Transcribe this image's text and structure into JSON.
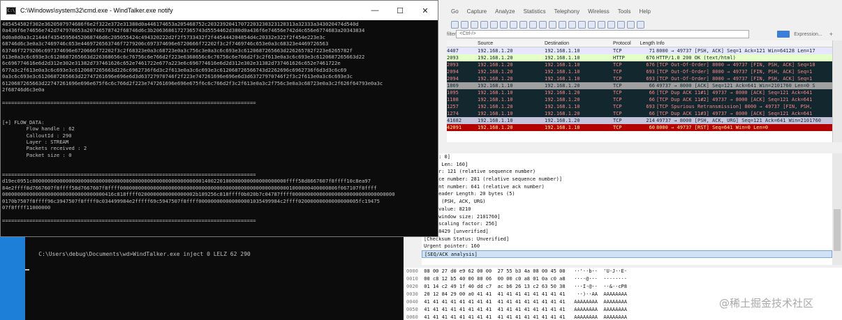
{
  "wireshark": {
    "menu": [
      "Go",
      "Capture",
      "Analyze",
      "Statistics",
      "Telephony",
      "Wireless",
      "Tools",
      "Help"
    ],
    "filter": {
      "label": "filter",
      "placeholder": "<Ctrl-/>",
      "expression_label": "Expression...",
      "plus": "+"
    },
    "packet_columns": [
      "Source",
      "Destination",
      "Protocol",
      "Length",
      "Info"
    ],
    "packets": [
      {
        "no": "4407",
        "src": "192.168.1.20",
        "dst": "192.168.1.10",
        "proto": "TCP",
        "len": "71",
        "info": "8000 → 49737 [PSH, ACK] Seq=1 Ack=121 Win=64128 Len=17",
        "bg": "#e7e6ff",
        "fg": "#12272e"
      },
      {
        "no": "2093",
        "src": "192.168.1.20",
        "dst": "192.168.1.10",
        "proto": "HTTP",
        "len": "676",
        "info": "HTTP/1.0 200 OK  (text/html)",
        "bg": "#e4ffc7",
        "fg": "#12272e"
      },
      {
        "no": "2093",
        "src": "192.168.1.20",
        "dst": "192.168.1.10",
        "proto": "TCP",
        "len": "676",
        "info": "[TCP Out-Of-Order] 8000 → 49737 [FIN, PSH, ACK] Seq=18",
        "bg": "#12272e",
        "fg": "#f78787"
      },
      {
        "no": "2094",
        "src": "192.168.1.20",
        "dst": "192.168.1.10",
        "proto": "TCP",
        "len": "693",
        "info": "[TCP Out-Of-Order] 8000 → 49737 [FIN, PSH, ACK] Seq=1",
        "bg": "#12272e",
        "fg": "#f78787"
      },
      {
        "no": "2094",
        "src": "192.168.1.20",
        "dst": "192.168.1.10",
        "proto": "TCP",
        "len": "693",
        "info": "[TCP Out-Of-Order] 8000 → 49737 [FIN, PSH, ACK] Seq=1",
        "bg": "#12272e",
        "fg": "#f78787"
      },
      {
        "no": "1869",
        "src": "192.168.1.10",
        "dst": "192.168.1.20",
        "proto": "TCP",
        "len": "66",
        "info": "49737 → 8000 [ACK] Seq=121 Ack=641 Win=2101760 Len=0 S",
        "bg": "#a0a0a0",
        "fg": "#12272e"
      },
      {
        "no": "1095",
        "src": "192.168.1.10",
        "dst": "192.168.1.20",
        "proto": "TCP",
        "len": "66",
        "info": "[TCP Dup ACK 11#1] 49737 → 8000 [ACK] Seq=121 Ack=641",
        "bg": "#12272e",
        "fg": "#f78787"
      },
      {
        "no": "1108",
        "src": "192.168.1.10",
        "dst": "192.168.1.20",
        "proto": "TCP",
        "len": "66",
        "info": "[TCP Dup ACK 11#2] 49737 → 8000 [ACK] Seq=121 Ack=641",
        "bg": "#12272e",
        "fg": "#f78787"
      },
      {
        "no": "1257",
        "src": "192.168.1.20",
        "dst": "192.168.1.10",
        "proto": "TCP",
        "len": "693",
        "info": "[TCP Spurious Retransmission] 8000 → 49737 [FIN, PSH,",
        "bg": "#12272e",
        "fg": "#f78787"
      },
      {
        "no": "1274",
        "src": "192.168.1.10",
        "dst": "192.168.1.20",
        "proto": "TCP",
        "len": "66",
        "info": "[TCP Dup ACK 11#3] 49737 → 8000 [ACK] Seq=121 Ack=641",
        "bg": "#12272e",
        "fg": "#f78787"
      },
      {
        "no": "41682",
        "src": "192.168.1.10",
        "dst": "192.168.1.20",
        "proto": "TCP",
        "len": "214",
        "info": "49737 → 8000 [PSH, ACK, URG] Seq=121 Ack=641 Win=2101760",
        "bg": "#c4c4dc",
        "fg": "#12272e"
      },
      {
        "no": "42091",
        "src": "192.168.1.20",
        "dst": "192.168.1.10",
        "proto": "TCP",
        "len": "60",
        "info": "8000 → 49737 [RST] Seq=641 Win=0 Len=0",
        "bg": "#b30000",
        "fg": "#fffc9c"
      }
    ],
    "details": [
      "index: 0]",
      "gment Len: 160]",
      "number: 121    (relative sequence number)",
      "equence number: 281    (relative sequence number)]",
      "edgment number: 641    (relative ack number)",
      ". = Header Length: 20 bytes (5)",
      "0x038 (PSH, ACK, URG)",
      "size value: 8210",
      "ated window size: 2101760]",
      "size scaling factor: 256]",
      "m: 0x8429 [unverified]",
      "[Checksum Status: Unverified]",
      "Urgent pointer: 160",
      "[SEQ/ACK analysis]"
    ],
    "bytes": [
      {
        "off": "0000",
        "hex": "08 00 27 d0 e9 62 00 00  27 55 b3 4a 08 00 45 00",
        "ascii": "··'··b··  'U·J··E·"
      },
      {
        "off": "0010",
        "hex": "00 c8 12 b5 40 00 80 06  00 00 c0 a8 01 0a c0 a8",
        "ascii": "····@···  ········"
      },
      {
        "off": "0020",
        "hex": "01 14 c2 49 1f 40 dd c7  ac b6 26 13 c2 63 50 38",
        "ascii": "···I·@··  ··&··cP8"
      },
      {
        "off": "0030",
        "hex": "20 12 84 29 00 a0 41 41  41 41 41 41 41 41 41 41",
        "ascii": " ··)··AA  AAAAAAAA"
      },
      {
        "off": "0040",
        "hex": "41 41 41 41 41 41 41 41  41 41 41 41 41 41 41 41",
        "ascii": "AAAAAAAA  AAAAAAAA"
      },
      {
        "off": "0050",
        "hex": "41 41 41 41 41 41 41 41  41 41 41 41 41 41 41 41",
        "ascii": "AAAAAAAA  AAAAAAAA"
      },
      {
        "off": "0060",
        "hex": "41 41 41 41 41 41 41 41  41 41 41 41 41 41 41 41",
        "ascii": "AAAAAAAA  AAAAAAAA"
      }
    ],
    "watermark": "@稀土掘金技术社区"
  },
  "cmd_notify": {
    "title": "C:\\Windows\\system32\\cmd.exe - WindTalker.exe  notify",
    "icon": "C:\\",
    "minimize": "—",
    "maximize": "☐",
    "close": "✕",
    "lines": [
      "485454502f302e3620507974686f6e2f322e372e31380d0a446174653a205468752c20323920417072203230323120313a32333a343020474d540d",
      "0a436f6e74656e742d747970653a20746578742f68746d6c3b20636861727365743d5554462d380d0a436f6e74656e742d4c656e6774683a20343834",
      "0d0a0d0a3c21444f43545950452068746d6c205055424c494320222d2f2f5733432f2f445444204854d4c20332e322f2f454e223e3c",
      "68746d6c3e0a3c7469746c653e4469726563746f7279206c697374696e6720666f72202f3c2f7469746c653e0a3c68323e4469726563",
      "63746f7279206c697374696e6720666f72202f3c2f68323e0a3c68723e0a3c756c3e0a3c6c693e3c6120687265663d226265782f223e6265782f",
      "613e0a3c6c693e3c6120687265663d226368656c6c76756c6e766d2f223e6368656c6c76756c6e766d2f3c2f613e0a3c6c693e3c6120687265663d22",
      "6c696774616e6d2d312e302e31382d737461626c652e7461722e677a223e6c696774616e6d2d312e302e31382d737461626c652e7461722e",
      "677a3c2f613e0a3c6c693e3c6120687265663d226c6962736f6d3c2f613e0a3c6c693e3c612068726566743d2262696c6962736f6d3d3c6c69",
      "0a3c6c693e3c6120687265663d22747261696e696e6d3d63727970746f2f223e747261696e696e6d3d63727970746f2f3c2f613e0a3c6c693e3c",
      "6120687265663d22747261696e696e675f6c6c766d2f223e747261696e696e675f6c6c766d2f3c2f613e0a3c2f756c3e0a3c68723e0a3c2f626f64793e0a3c",
      "2f68746d6c3e0a",
      "",
      "====================================================================================",
      "",
      "",
      "[+] FLOW_DATA:",
      "        Flow handle : 62",
      "        CalloutId : 290",
      "        Layer : STREAM",
      "        Packets received : 2",
      "        Packet size : 0",
      "",
      "",
      "====================================================================================",
      "d19ec0951c000000000000000000000000000000000000000000000000000000001400220100000000000000000000ffff58d8667607f8ffff10c8ea97",
      "84e2ffff8d7667607f8ffff58d7667607f8ffff000000000000000000000000000000000000000000000000000000001000000400000806f067107f8ffff",
      "0000000000000000000000000000000000416c818ffff0200000000000000002b189256c818ffff0b020b7c04787ffff0000000000000000000000000000000000",
      "0170b7507f8ffff96c3947507f8ffff0c034499984e2fffff69c5947507f8ffff000000000000000001035499984c2ffff02000000000000000005fc19475",
      "07f8ffff11000000",
      "",
      "===================================================================================="
    ]
  },
  "cmd_inject": {
    "command_line": "C:\\Users\\debug\\Documents\\wd>WindTalker.exe inject 0 LELZ 62 290"
  }
}
